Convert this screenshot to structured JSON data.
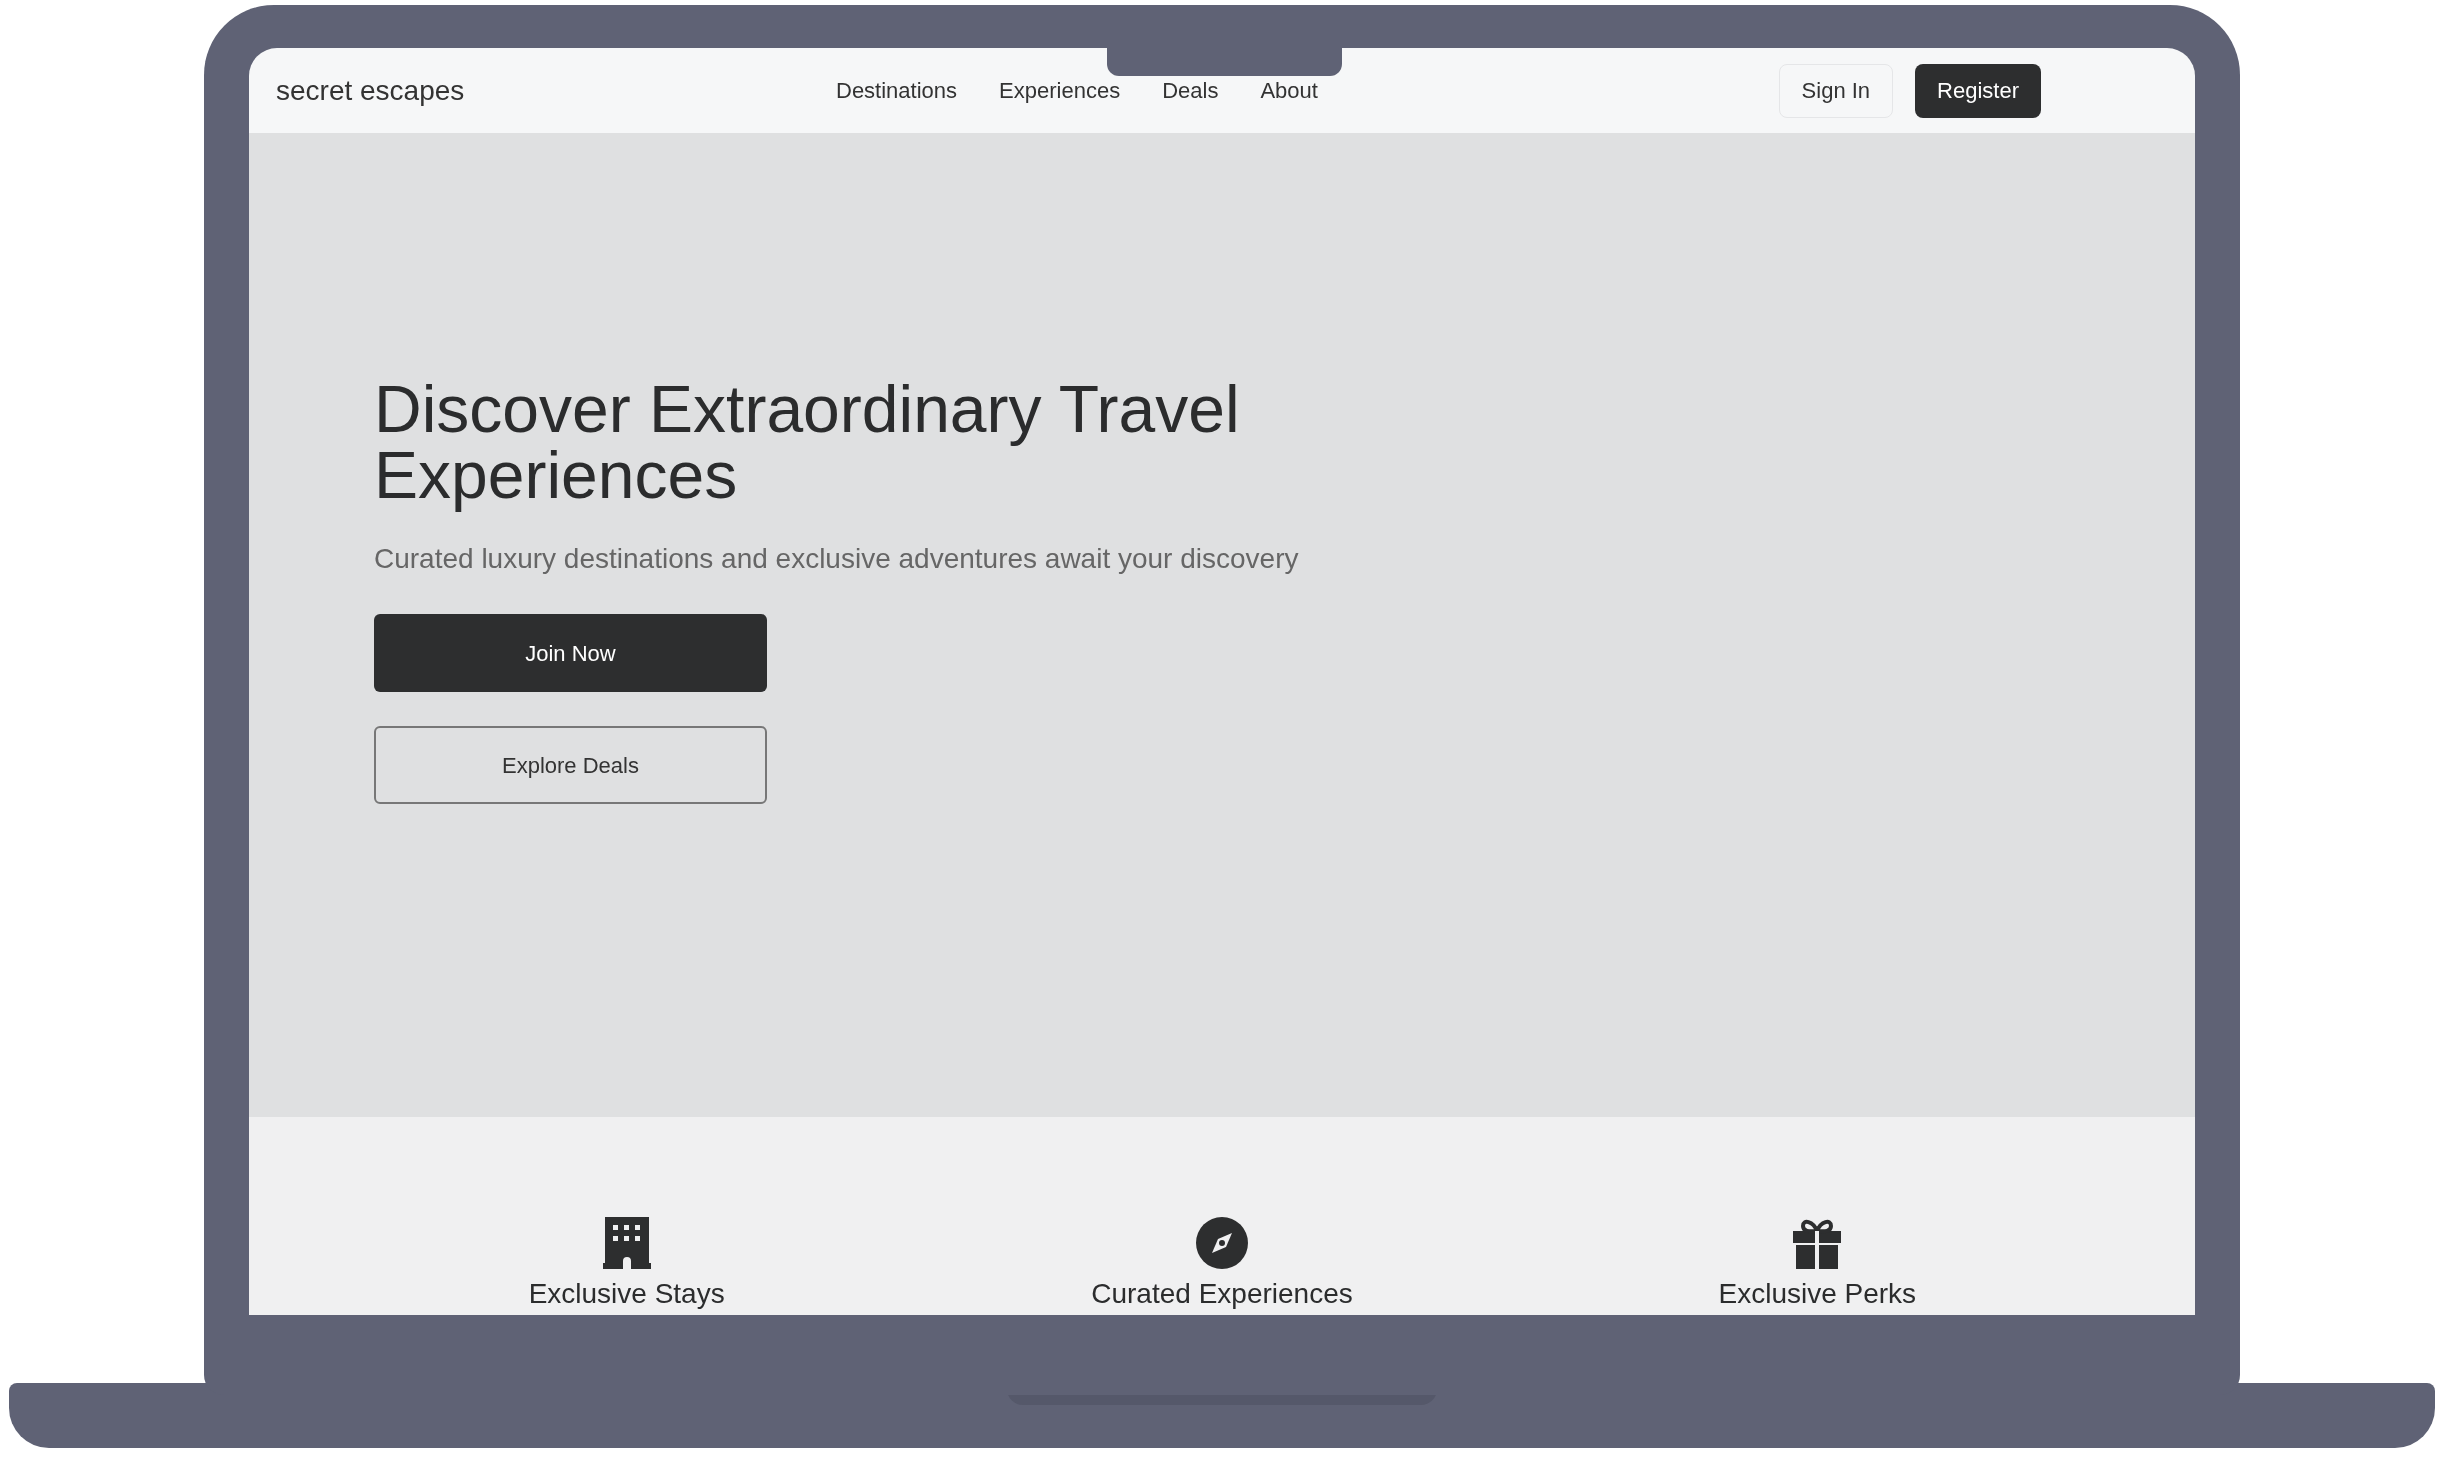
{
  "nav": {
    "logo": "secret escapes",
    "links": [
      "Destinations",
      "Experiences",
      "Deals",
      "About"
    ],
    "sign_in": "Sign In",
    "register": "Register"
  },
  "hero": {
    "title": "Discover Extraordinary Travel Experiences",
    "subtitle": "Curated luxury destinations and exclusive adventures await your discovery",
    "primary_button": "Join Now",
    "secondary_button": "Explore Deals"
  },
  "features": [
    {
      "kind": "building",
      "title": "Exclusive Stays"
    },
    {
      "kind": "compass",
      "title": "Curated Experiences"
    },
    {
      "kind": "gift",
      "title": "Exclusive Perks"
    }
  ]
}
